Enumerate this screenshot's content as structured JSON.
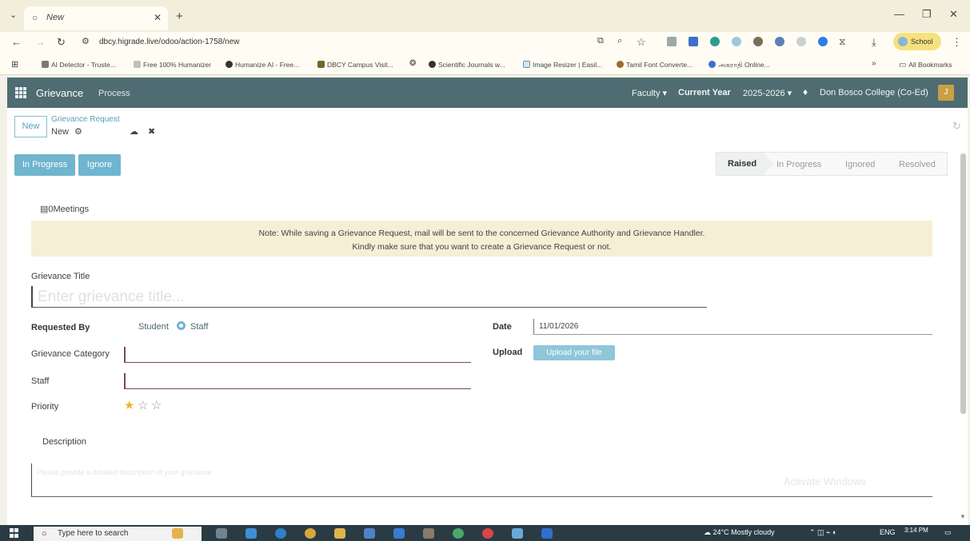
{
  "browser": {
    "tab_title": "New",
    "url": "dbcy.higrade.live/odoo/action-1758/new",
    "profile": "School",
    "bookmarks": [
      "AI Detector - Truste...",
      "Free 100% Humanizer",
      "Humanize AI - Free...",
      "DBCY Campus Visit...",
      "Scientific Journals w...",
      "Image Resizer | Easil...",
      "Tamil Font Converte...",
      "அகராதி Online..."
    ],
    "all_bookmarks": "All Bookmarks"
  },
  "navbar": {
    "app": "Grievance",
    "menu": "Process",
    "faculty": "Faculty",
    "current_year_label": "Current Year",
    "year": "2025-2026",
    "college": "Don Bosco College (Co-Ed)",
    "avatar_letter": "J"
  },
  "control": {
    "new_button": "New",
    "breadcrumb_parent": "Grievance Request",
    "breadcrumb_current": "New",
    "action_in_progress": "In Progress",
    "action_ignore": "Ignore",
    "stages": [
      "Raised",
      "In Progress",
      "Ignored",
      "Resolved"
    ],
    "active_stage": "Raised"
  },
  "form": {
    "meetings": "0Meetings",
    "note_line1": "Note: While saving a Grievance Request, mail will be sent to the concerned Grievance Authority and Grievance Handler.",
    "note_line2": "Kindly make sure that you want to create a Grievance Request or not.",
    "title_label": "Grievance Title",
    "title_placeholder": "Enter grievance title...",
    "requested_by_label": "Requested By",
    "requested_by_options": [
      "Student",
      "Staff"
    ],
    "requested_by_selected": "Staff",
    "category_label": "Grievance Category",
    "staff_label": "Staff",
    "priority_label": "Priority",
    "priority_value": 1,
    "priority_max": 3,
    "date_label": "Date",
    "date_value": "11/01/2026",
    "upload_label": "Upload",
    "upload_button": "Upload your file",
    "description_label": "Description",
    "description_placeholder": "Please provide a detailed description of your grievance",
    "watermark": "Activate Windows"
  },
  "taskbar": {
    "search_placeholder": "Type here to search",
    "weather": "24°C  Mostly cloudy",
    "language": "ENG",
    "time": "3:14 PM"
  },
  "colors": {
    "navbar": "#4f6c72",
    "accent": "#6fb5cf",
    "alert_bg": "#f6efd6",
    "star": "#f0b429"
  }
}
